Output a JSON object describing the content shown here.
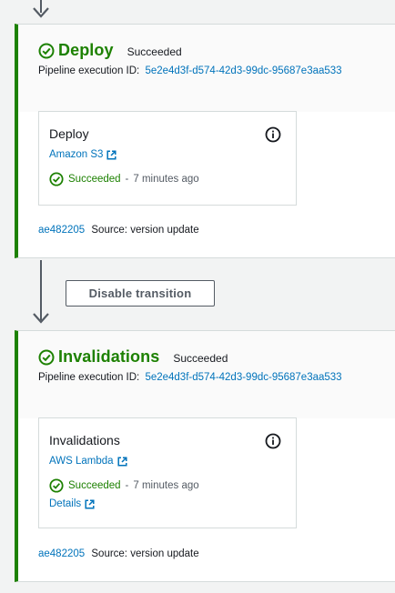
{
  "stages": [
    {
      "name": "Deploy",
      "status": "Succeeded",
      "exec_label": "Pipeline execution ID:",
      "exec_id": "5e2e4d3f-d574-42d3-99dc-95687e3aa533",
      "action": {
        "title": "Deploy",
        "provider": "Amazon S3",
        "status": "Succeeded",
        "separator": "-",
        "time": "7 minutes ago"
      },
      "source": {
        "commit": "ae482205",
        "text": "Source: version update"
      }
    },
    {
      "name": "Invalidations",
      "status": "Succeeded",
      "exec_label": "Pipeline execution ID:",
      "exec_id": "5e2e4d3f-d574-42d3-99dc-95687e3aa533",
      "action": {
        "title": "Invalidations",
        "provider": "AWS Lambda",
        "status": "Succeeded",
        "separator": "-",
        "time": "7 minutes ago",
        "details": "Details"
      },
      "source": {
        "commit": "ae482205",
        "text": "Source: version update"
      }
    }
  ],
  "transition": {
    "button_label": "Disable transition"
  },
  "icons": {
    "success": "check-circle-icon",
    "info": "info-icon",
    "external": "external-link-icon",
    "arrow": "arrow-down-icon"
  },
  "colors": {
    "success": "#1d8102",
    "link": "#0073bb",
    "text": "#16191f",
    "muted": "#545b64",
    "border": "#d5dbdb"
  }
}
